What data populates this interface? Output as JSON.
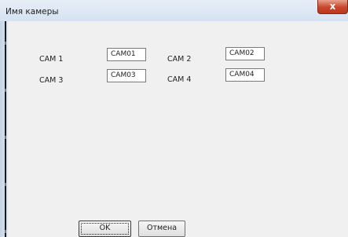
{
  "window": {
    "title": "Имя камеры",
    "close_glyph": "x",
    "close_icon": "close-icon"
  },
  "cameras": [
    {
      "label": "CAM 1",
      "value": "CAM01"
    },
    {
      "label": "CAM 2",
      "value": "CAM02"
    },
    {
      "label": "CAM 3",
      "value": "CAM03"
    },
    {
      "label": "CAM 4",
      "value": "CAM04"
    }
  ],
  "buttons": {
    "ok": "OK",
    "cancel": "Отмена"
  },
  "colors": {
    "close_button": "#c8462b",
    "background": "#f0f0f0"
  }
}
